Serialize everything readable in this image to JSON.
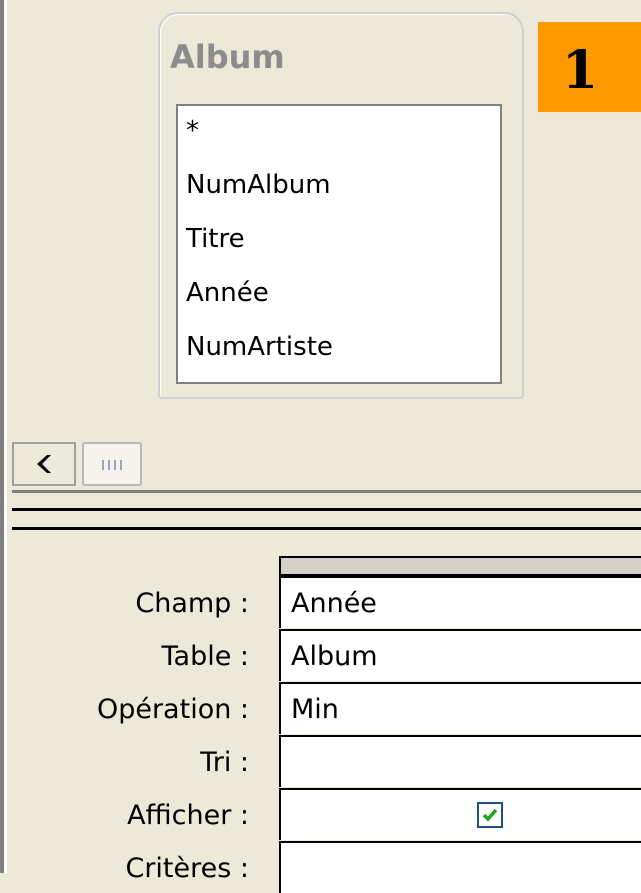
{
  "table": {
    "name": "Album",
    "fields": [
      "*",
      "NumAlbum",
      "Titre",
      "Année",
      "NumArtiste"
    ]
  },
  "badge": {
    "number": "1"
  },
  "grid": {
    "rows": [
      {
        "label": "Champ :",
        "value": "Année"
      },
      {
        "label": "Table :",
        "value": "Album"
      },
      {
        "label": "Opération :",
        "value": "Min"
      },
      {
        "label": "Tri :",
        "value": ""
      },
      {
        "label": "Afficher :",
        "value": "",
        "checked": true
      },
      {
        "label": "Critères :",
        "value": ""
      }
    ]
  },
  "icons": {
    "scroll_left": "chevron-left-icon",
    "scroll_thumb": "grip-icon",
    "checkbox": "checkmark-icon"
  },
  "colors": {
    "badge": "#ff9900",
    "window_bg": "#ece9d8",
    "checkmark": "#21a121"
  }
}
